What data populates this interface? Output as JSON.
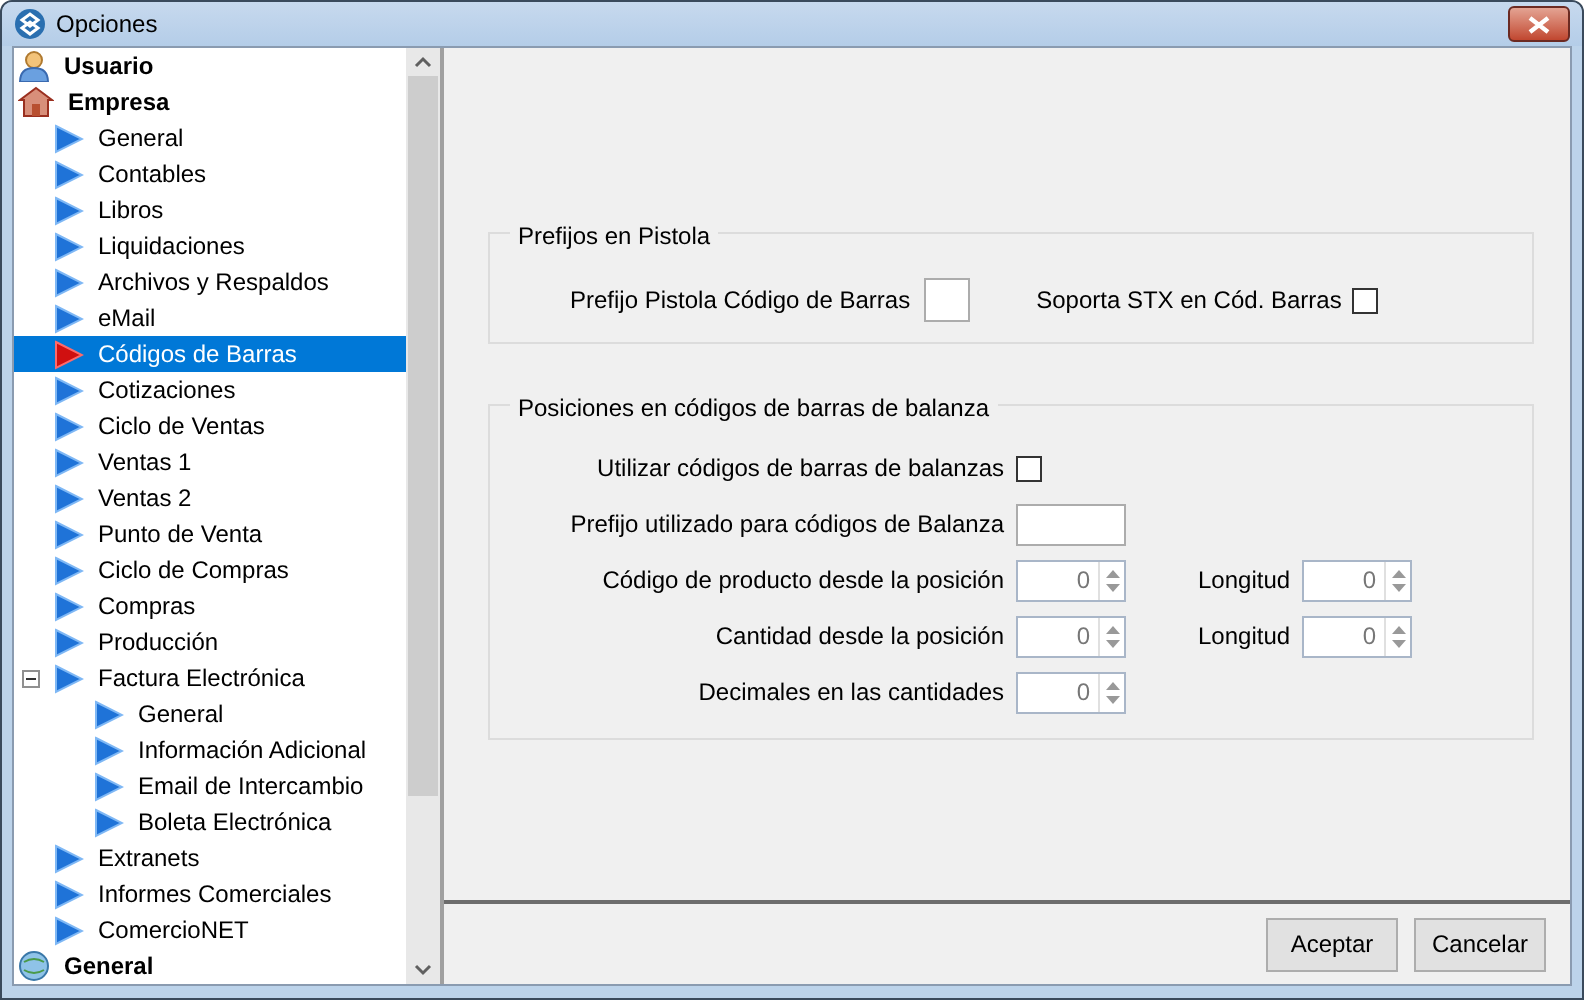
{
  "window": {
    "title": "Opciones"
  },
  "tree": [
    {
      "label": "Usuario",
      "kind": "user",
      "selected": false
    },
    {
      "label": "Empresa",
      "kind": "company",
      "selected": false,
      "children": [
        {
          "label": "General",
          "kind": "arrow",
          "selected": false
        },
        {
          "label": "Contables",
          "kind": "arrow",
          "selected": false
        },
        {
          "label": "Libros",
          "kind": "arrow",
          "selected": false
        },
        {
          "label": "Liquidaciones",
          "kind": "arrow",
          "selected": false
        },
        {
          "label": "Archivos y Respaldos",
          "kind": "arrow",
          "selected": false
        },
        {
          "label": "eMail",
          "kind": "arrow",
          "selected": false
        },
        {
          "label": "Códigos de Barras",
          "kind": "arrow",
          "selected": true
        },
        {
          "label": "Cotizaciones",
          "kind": "arrow",
          "selected": false
        },
        {
          "label": "Ciclo de Ventas",
          "kind": "arrow",
          "selected": false
        },
        {
          "label": "Ventas 1",
          "kind": "arrow",
          "selected": false
        },
        {
          "label": "Ventas 2",
          "kind": "arrow",
          "selected": false
        },
        {
          "label": "Punto de Venta",
          "kind": "arrow",
          "selected": false
        },
        {
          "label": "Ciclo de Compras",
          "kind": "arrow",
          "selected": false
        },
        {
          "label": "Compras",
          "kind": "arrow",
          "selected": false
        },
        {
          "label": "Producción",
          "kind": "arrow",
          "selected": false
        },
        {
          "label": "Factura Electrónica",
          "kind": "arrow",
          "selected": false,
          "expanded": true,
          "children": [
            {
              "label": "General",
              "kind": "arrow",
              "selected": false
            },
            {
              "label": "Información Adicional",
              "kind": "arrow",
              "selected": false
            },
            {
              "label": "Email de Intercambio",
              "kind": "arrow",
              "selected": false
            },
            {
              "label": "Boleta Electrónica",
              "kind": "arrow",
              "selected": false
            }
          ]
        },
        {
          "label": "Extranets",
          "kind": "arrow",
          "selected": false
        },
        {
          "label": "Informes Comerciales",
          "kind": "arrow",
          "selected": false
        },
        {
          "label": "ComercioNET",
          "kind": "arrow",
          "selected": false
        }
      ]
    },
    {
      "label": "General",
      "kind": "globe",
      "selected": false
    }
  ],
  "prefijos": {
    "title": "Prefijos en Pistola",
    "prefix_label": "Prefijo Pistola Código de Barras",
    "stx_label": "Soporta STX en Cód. Barras",
    "stx_checked": false
  },
  "balanza": {
    "title": "Posiciones en códigos de barras de balanza",
    "rows": [
      {
        "kind": "checkbox",
        "label": "Utilizar códigos de barras de balanzas",
        "checked": false
      },
      {
        "kind": "text",
        "label": "Prefijo utilizado para códigos de Balanza"
      },
      {
        "kind": "spinner",
        "label": "Código de producto desde la posición",
        "value": "0",
        "extra": {
          "label": "Longitud",
          "value": "0"
        }
      },
      {
        "kind": "spinner",
        "label": "Cantidad desde la posición",
        "value": "0",
        "extra": {
          "label": "Longitud",
          "value": "0"
        }
      },
      {
        "kind": "spinner",
        "label": "Decimales en las cantidades",
        "value": "0"
      }
    ]
  },
  "buttons": [
    "Aceptar",
    "Cancelar"
  ]
}
